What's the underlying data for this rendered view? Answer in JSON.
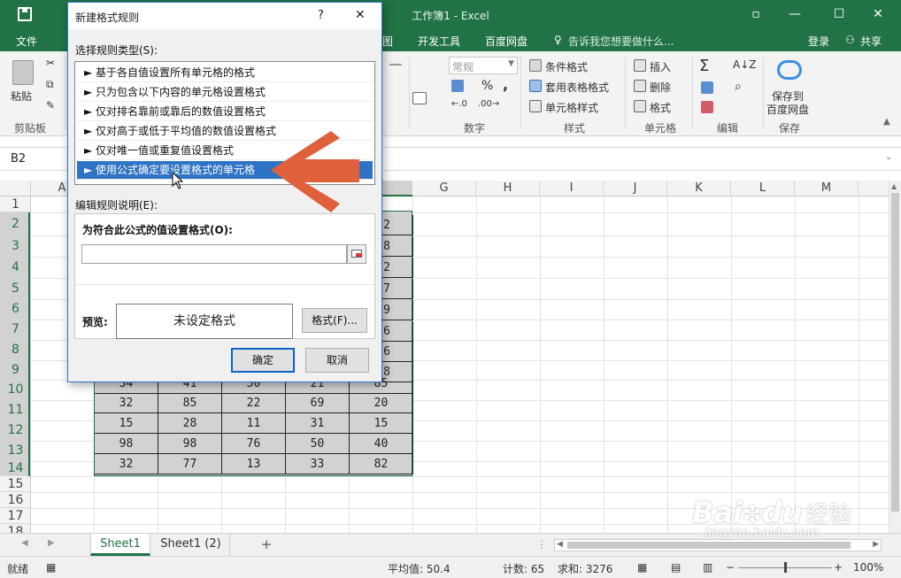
{
  "app": {
    "window_title": "工作簿1 - Excel",
    "restore_icon": "restore-icon",
    "minimize_icon": "minimize-icon",
    "maximize_icon": "maximize-icon",
    "close_icon": "close-icon"
  },
  "menu": {
    "file": "文件",
    "view_partial": "图",
    "developer": "开发工具",
    "baidu": "百度网盘",
    "tellme": "告诉我您想要做什么...",
    "login": "登录",
    "share": "共享"
  },
  "ribbon": {
    "clipboard": {
      "paste": "粘贴",
      "label": "剪贴板"
    },
    "number": {
      "format_value": "常规",
      "percent": "%",
      "comma": ",",
      "label": "数字"
    },
    "styles": {
      "conditional": "条件格式",
      "table": "套用表格格式",
      "cell": "单元格样式",
      "label": "样式"
    },
    "cells": {
      "insert": "插入",
      "delete": "删除",
      "format": "格式",
      "label": "单元格"
    },
    "editing": {
      "sum": "Σ",
      "label": "编辑"
    },
    "save": {
      "line1": "保存到",
      "line2": "百度网盘",
      "label": "保存"
    }
  },
  "formula_bar": {
    "name_box": "B2"
  },
  "columns": [
    "A",
    "G",
    "H",
    "I",
    "J",
    "K",
    "L",
    "M"
  ],
  "rows": [
    "1",
    "2",
    "3",
    "4",
    "5",
    "6",
    "7",
    "8",
    "9",
    "10",
    "11",
    "12",
    "13",
    "14",
    "15",
    "16",
    "17",
    "18"
  ],
  "cells_visible_right": [
    "2",
    "8",
    "2",
    "7",
    "9",
    "6",
    "6",
    "8"
  ],
  "table_rows": [
    [
      "34",
      "41",
      "50",
      "21",
      "85"
    ],
    [
      "32",
      "85",
      "22",
      "69",
      "20"
    ],
    [
      "15",
      "28",
      "11",
      "31",
      "15"
    ],
    [
      "98",
      "98",
      "76",
      "50",
      "40"
    ],
    [
      "32",
      "77",
      "13",
      "33",
      "82"
    ]
  ],
  "sheets": {
    "active": "Sheet1",
    "other": "Sheet1 (2)",
    "add": "+"
  },
  "status": {
    "ready": "就绪",
    "average": "平均值: 50.4",
    "count": "计数: 65",
    "sum": "求和: 3276",
    "zoom": "100%"
  },
  "dialog": {
    "title": "新建格式规则",
    "help": "?",
    "close": "✕",
    "select_type_label": "选择规则类型(S):",
    "rules": [
      "► 基于各自值设置所有单元格的格式",
      "► 只为包含以下内容的单元格设置格式",
      "► 仅对排名靠前或靠后的数值设置格式",
      "► 仅对高于或低于平均值的数值设置格式",
      "► 仅对唯一值或重复值设置格式",
      "► 使用公式确定要设置格式的单元格"
    ],
    "selected_index": 5,
    "edit_label": "编辑规则说明(E):",
    "formula_label": "为符合此公式的值设置格式(O):",
    "formula_value": "",
    "preview_label": "预览:",
    "preview_text": "未设定格式",
    "format_button": "格式(F)...",
    "ok": "确定",
    "cancel": "取消"
  },
  "watermark": {
    "brand": "Bai",
    "suffix": "du",
    "cn": "经验",
    "url": "jingyan.baidu.com"
  },
  "colors": {
    "excel_green": "#217346",
    "selection": "#2f74c4",
    "arrow": "#e0603c",
    "data_fill": "#d2d2d2"
  }
}
